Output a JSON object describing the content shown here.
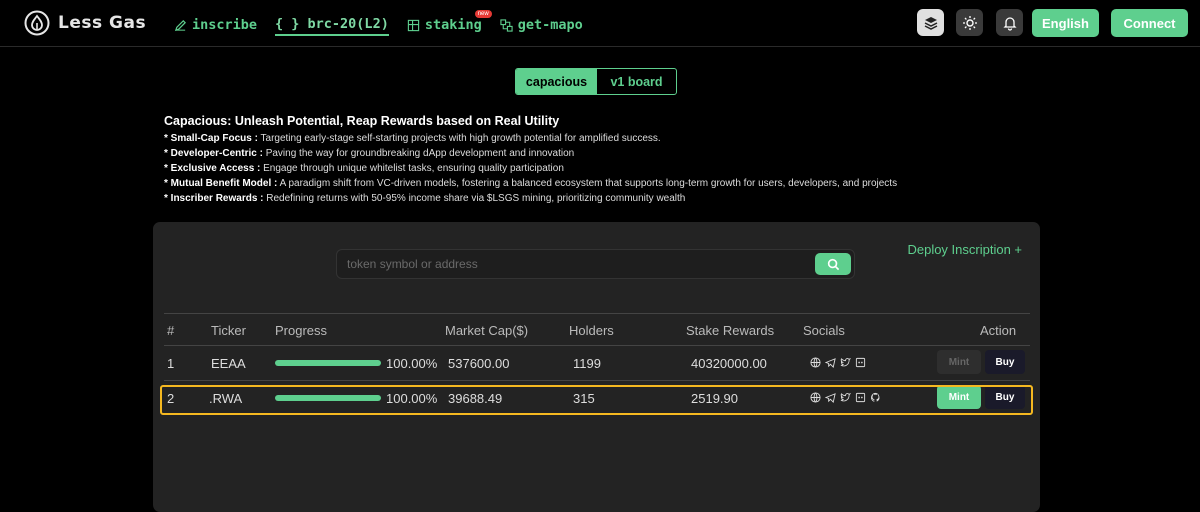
{
  "brand": {
    "name": "Less Gas"
  },
  "nav": [
    {
      "label": "inscribe",
      "icon": "pencil-icon"
    },
    {
      "label": "{ } brc-20(L2)",
      "icon": ""
    },
    {
      "label": "staking",
      "icon": "grid-icon",
      "badge": "new"
    },
    {
      "label": "get-mapo",
      "icon": "link-icon"
    }
  ],
  "header": {
    "language": "English",
    "connect": "Connect"
  },
  "tabs": {
    "active": "capacious",
    "other": "v1 board"
  },
  "intro": {
    "title": "Capacious: Unleash Potential, Reap Rewards based on Real Utility",
    "lines": [
      {
        "key": "* Small-Cap Focus :",
        "text": " Targeting early-stage self-starting projects with high growth potential for amplified success."
      },
      {
        "key": "* Developer-Centric :",
        "text": " Paving the way for groundbreaking dApp development and innovation"
      },
      {
        "key": "* Exclusive Access :",
        "text": " Engage through unique whitelist tasks, ensuring quality participation"
      },
      {
        "key": "* Mutual Benefit Model :",
        "text": " A paradigm shift from VC-driven models, fostering a balanced ecosystem that supports long-term growth for users, developers, and projects"
      },
      {
        "key": "* Inscriber Rewards :",
        "text": " Redefining returns with 50-95% income share via $LSGS mining, prioritizing community wealth"
      }
    ]
  },
  "search": {
    "placeholder": "token symbol or address"
  },
  "deploy": "Deploy Inscription +",
  "table": {
    "headers": [
      "#",
      "Ticker",
      "Progress",
      "Market Cap($)",
      "Holders",
      "Stake Rewards",
      "Socials",
      "Action"
    ],
    "rows": [
      {
        "num": "1",
        "ticker": "EEAA",
        "progress": 1.0,
        "progress_text": "100.00%",
        "market_cap": "537600.00",
        "holders": "1199",
        "stake": "40320000.00",
        "mint": "Mint",
        "buy": "Buy",
        "mint_enabled": false
      },
      {
        "num": "2",
        "ticker": ".RWA",
        "progress": 1.0,
        "progress_text": "100.00%",
        "market_cap": "39688.49",
        "holders": "315",
        "stake": "2519.90",
        "mint": "Mint",
        "buy": "Buy",
        "mint_enabled": true
      }
    ]
  },
  "colors": {
    "accent": "#5ecf8e",
    "highlight": "#f5b820"
  }
}
